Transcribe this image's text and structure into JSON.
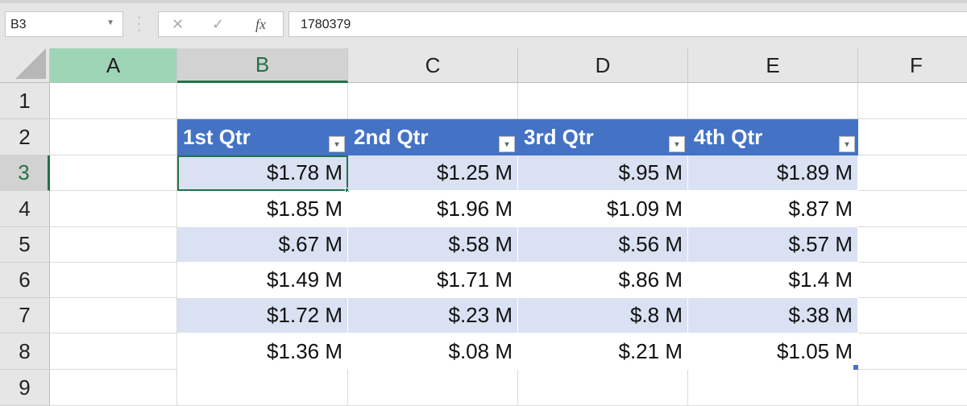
{
  "formula_bar": {
    "name_box": "B3",
    "cancel_icon": "✕",
    "enter_icon": "✓",
    "fx_label": "fx",
    "formula": "1780379"
  },
  "columns": [
    "A",
    "B",
    "C",
    "D",
    "E",
    "F"
  ],
  "rows": [
    "1",
    "2",
    "3",
    "4",
    "5",
    "6",
    "7",
    "8",
    "9"
  ],
  "table": {
    "headers": [
      "1st Qtr",
      "2nd Qtr",
      "3rd Qtr",
      "4th Qtr"
    ],
    "rows": [
      [
        "$1.78 M",
        "$1.25 M",
        "$.95 M",
        "$1.89 M"
      ],
      [
        "$1.85 M",
        "$1.96 M",
        "$1.09 M",
        "$.87 M"
      ],
      [
        "$.67 M",
        "$.58 M",
        "$.56 M",
        "$.57 M"
      ],
      [
        "$1.49 M",
        "$1.71 M",
        "$.86 M",
        "$1.4 M"
      ],
      [
        "$1.72 M",
        "$.23 M",
        "$.8 M",
        "$.38 M"
      ],
      [
        "$1.36 M",
        "$.08 M",
        "$.21 M",
        "$1.05 M"
      ]
    ]
  },
  "colors": {
    "header": "#4472c4",
    "band": "#d9e1f2",
    "accent": "#217346"
  }
}
